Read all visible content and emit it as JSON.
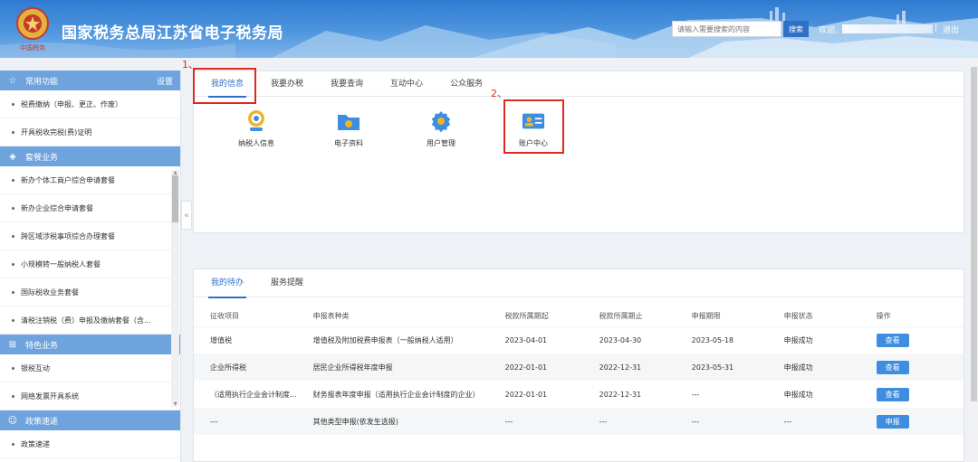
{
  "header": {
    "title": "国家税务总局江苏省电子税务局",
    "search_placeholder": "请输入需要搜索的内容",
    "search_button": "搜索",
    "welcome": "欢迎,",
    "separator": "|",
    "logout": "退出",
    "brand_color": "#2f7bd0"
  },
  "sidebar": {
    "sections": [
      {
        "title": "常用功能",
        "icon": "star-icon",
        "action": "设置",
        "items": [
          "税费缴纳（申报、更正、作废）",
          "开具税收完税(费)证明"
        ]
      },
      {
        "title": "套餐业务",
        "icon": "layers-icon",
        "action": "",
        "items": [
          "新办个体工商户综合申请套餐",
          "新办企业综合申请套餐",
          "跨区域涉税事项综合办理套餐",
          "小规模转一般纳税人套餐",
          "国际税收业务套餐",
          "清税注销税（费）申报及缴纳套餐（含..."
        ]
      },
      {
        "title": "特色业务",
        "icon": "grid-icon",
        "action": "",
        "items": [
          "银税互动",
          "网络发票开具系统"
        ]
      },
      {
        "title": "政策速递",
        "icon": "user-icon",
        "action": "",
        "items": [
          "政策速递"
        ]
      }
    ],
    "collapse_icon": "«"
  },
  "top_panel": {
    "tabs": [
      "我的信息",
      "我要办税",
      "我要查询",
      "互动中心",
      "公众服务"
    ],
    "active_tab": 0,
    "tiles": [
      {
        "label": "纳税人信息",
        "icon": "taxpayer-info-icon"
      },
      {
        "label": "电子资料",
        "icon": "folder-icon"
      },
      {
        "label": "用户管理",
        "icon": "gear-icon"
      },
      {
        "label": "账户中心",
        "icon": "account-card-icon"
      }
    ],
    "annotations": [
      "1、",
      "2、"
    ]
  },
  "bottom_panel": {
    "tabs": [
      "我的待办",
      "服务提醒"
    ],
    "active_tab": 0,
    "columns": [
      "征收项目",
      "申报表种类",
      "税款所属期起",
      "税款所属期止",
      "申报期限",
      "申报状态",
      "操作"
    ],
    "rows": [
      [
        "增值税",
        "增值税及附加税费申报表（一般纳税人适用）",
        "2023-04-01",
        "2023-04-30",
        "2023-05-18",
        "申报成功",
        "查看"
      ],
      [
        "企业所得税",
        "居民企业所得税年度申报",
        "2022-01-01",
        "2022-12-31",
        "2023-05-31",
        "申报成功",
        "查看"
      ],
      [
        "（适用执行企业会计制度...",
        "财务报表年度申报（适用执行企业会计制度的企业）",
        "2022-01-01",
        "2022-12-31",
        "---",
        "申报成功",
        "查看"
      ],
      [
        "---",
        "其他类型申报(依发生选报)",
        "---",
        "---",
        "---",
        "---",
        "申报"
      ]
    ]
  }
}
